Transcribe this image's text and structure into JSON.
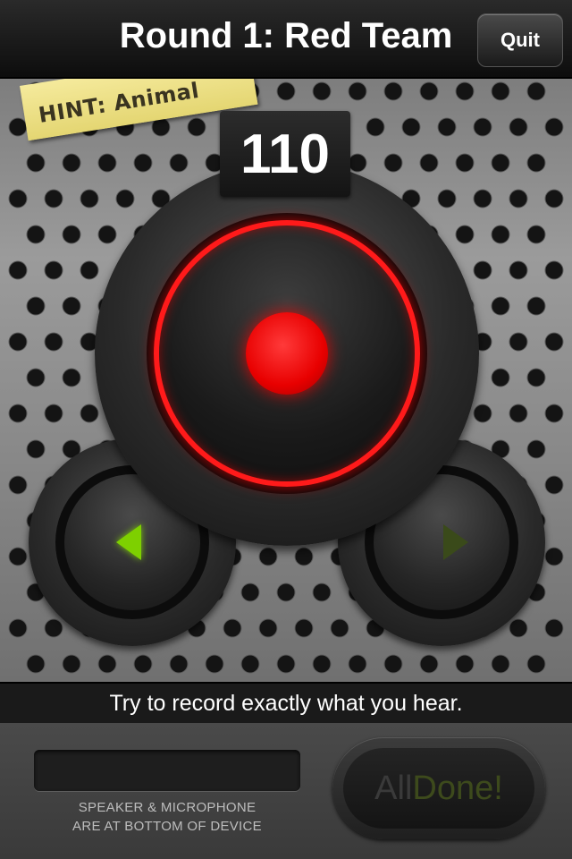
{
  "header": {
    "title": "Round 1: Red Team",
    "quit_label": "Quit"
  },
  "hint": {
    "text": "HINT: Animal"
  },
  "counter": {
    "value": "110"
  },
  "controls": {
    "record": "record-button",
    "prev": "play-left-icon",
    "next": "play-right-icon"
  },
  "instruction": "Try to record exactly what you hear.",
  "bottom": {
    "note_line1": "SPEAKER & MICROPHONE",
    "note_line2": "ARE AT BOTTOM OF DEVICE",
    "all_label": "All",
    "done_label": "Done!"
  },
  "colors": {
    "record_red": "#ff1a1a",
    "active_green": "#7ed000",
    "inactive_green": "#3a4a1a",
    "hint_note": "#f5ea9c"
  }
}
